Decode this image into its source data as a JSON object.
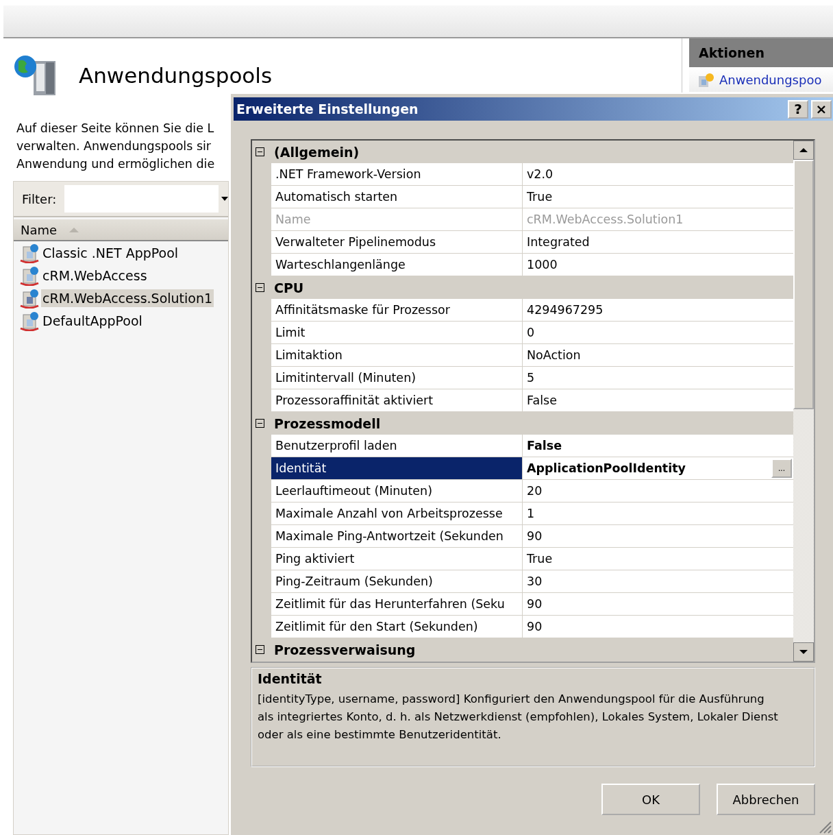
{
  "page": {
    "title": "Anwendungspools",
    "description_lines": [
      "Auf dieser Seite können Sie die L",
      "verwalten. Anwendungspools sir",
      "Anwendung und ermöglichen die"
    ]
  },
  "filter": {
    "label": "Filter:"
  },
  "pool_list": {
    "column": "Name",
    "items": [
      {
        "name": "Classic .NET AppPool",
        "selected": false
      },
      {
        "name": "cRM.WebAccess",
        "selected": false
      },
      {
        "name": "cRM.WebAccess.Solution1",
        "selected": true
      },
      {
        "name": "DefaultAppPool",
        "selected": false
      }
    ]
  },
  "actions": {
    "title": "Aktionen",
    "link": "Anwendungspoo"
  },
  "dialog": {
    "title": "Erweiterte Einstellungen",
    "help": "?",
    "close": "×",
    "categories": [
      {
        "name": "(Allgemein)",
        "expanded": true,
        "properties": [
          {
            "name": ".NET Framework-Version",
            "value": "v2.0",
            "disabled": false,
            "modified": false,
            "selected": false
          },
          {
            "name": "Automatisch starten",
            "value": "True",
            "disabled": false,
            "modified": false,
            "selected": false
          },
          {
            "name": "Name",
            "value": "cRM.WebAccess.Solution1",
            "disabled": true,
            "modified": false,
            "selected": false
          },
          {
            "name": "Verwalteter Pipelinemodus",
            "value": "Integrated",
            "disabled": false,
            "modified": false,
            "selected": false
          },
          {
            "name": "Warteschlangenlänge",
            "value": "1000",
            "disabled": false,
            "modified": false,
            "selected": false
          }
        ]
      },
      {
        "name": "CPU",
        "expanded": true,
        "properties": [
          {
            "name": "Affinitätsmaske für Prozessor",
            "value": "4294967295",
            "disabled": false,
            "modified": false,
            "selected": false
          },
          {
            "name": "Limit",
            "value": "0",
            "disabled": false,
            "modified": false,
            "selected": false
          },
          {
            "name": "Limitaktion",
            "value": "NoAction",
            "disabled": false,
            "modified": false,
            "selected": false
          },
          {
            "name": "Limitintervall (Minuten)",
            "value": "5",
            "disabled": false,
            "modified": false,
            "selected": false
          },
          {
            "name": "Prozessoraffinität aktiviert",
            "value": "False",
            "disabled": false,
            "modified": false,
            "selected": false
          }
        ]
      },
      {
        "name": "Prozessmodell",
        "expanded": true,
        "properties": [
          {
            "name": "Benutzerprofil laden",
            "value": "False",
            "disabled": false,
            "modified": true,
            "selected": false
          },
          {
            "name": "Identität",
            "value": "ApplicationPoolIdentity",
            "disabled": false,
            "modified": true,
            "selected": true,
            "button": "..."
          },
          {
            "name": "Leerlauftimeout (Minuten)",
            "value": "20",
            "disabled": false,
            "modified": false,
            "selected": false
          },
          {
            "name": "Maximale Anzahl von Arbeitsprozesse",
            "value": "1",
            "disabled": false,
            "modified": false,
            "selected": false
          },
          {
            "name": "Maximale Ping-Antwortzeit (Sekunden",
            "value": "90",
            "disabled": false,
            "modified": false,
            "selected": false
          },
          {
            "name": "Ping aktiviert",
            "value": "True",
            "disabled": false,
            "modified": false,
            "selected": false
          },
          {
            "name": "Ping-Zeitraum (Sekunden)",
            "value": "30",
            "disabled": false,
            "modified": false,
            "selected": false
          },
          {
            "name": "Zeitlimit für das Herunterfahren (Seku",
            "value": "90",
            "disabled": false,
            "modified": false,
            "selected": false
          },
          {
            "name": "Zeitlimit für den Start (Sekunden)",
            "value": "90",
            "disabled": false,
            "modified": false,
            "selected": false
          }
        ]
      },
      {
        "name": "Prozessverwaisung",
        "expanded": true
      }
    ],
    "help_title": "Identität",
    "help_text": "[identityType, username, password] Konfiguriert den Anwendungspool für die Ausführung als integriertes Konto, d. h. als Netzwerkdienst (empfohlen), Lokales System, Lokaler Dienst oder als eine bestimmte Benutzeridentität.",
    "buttons": [
      "OK",
      "Abbrechen"
    ]
  }
}
